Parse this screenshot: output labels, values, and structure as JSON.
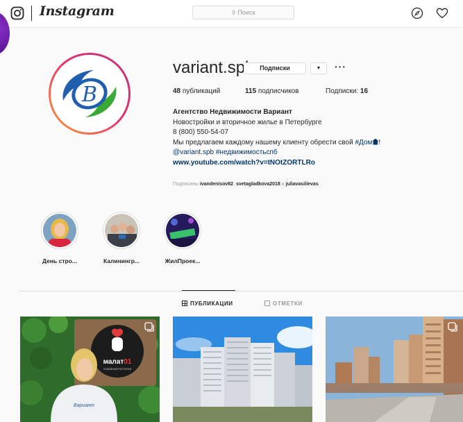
{
  "nav": {
    "brand": "Instagram",
    "search_placeholder": "Поиск"
  },
  "profile": {
    "username": "variant.spb",
    "follow_label": "Подписки",
    "stats": {
      "posts_count": "48",
      "posts_label": "публикаций",
      "followers_count": "115",
      "followers_label": "подписчиков",
      "following_label": "Подписки:",
      "following_count": "16"
    },
    "bio": {
      "name": "Агентство Недвижимости Вариант",
      "line1": "Новостройки и вторичное жилье в Петербурге",
      "phone": "8 (800) 550-54-07",
      "line3_text": "Мы предлагаем каждому нашему клиенту обрести свой",
      "line3_tag": "#Дом",
      "line3_end": "!",
      "line4_mention": "@variant.spb",
      "line4_tag": "#недвижимостьспб",
      "website": "www.youtube.com/watch?v=tNOtZORTLRo"
    },
    "followed_by": {
      "prefix": "Подписаны",
      "user1": "ivandenisov82",
      "sep": ",",
      "user2": "svetagladkova2018",
      "and": "и",
      "user3": "juliavasilievas"
    }
  },
  "highlights": [
    {
      "label": "День стро..."
    },
    {
      "label": "Калинингр..."
    },
    {
      "label": "ЖилПроек..."
    }
  ],
  "tabs": {
    "posts": "ПУБЛИКАЦИИ",
    "tagged": "ОТМЕТКИ"
  },
  "posts": [
    {
      "sign_text": "малат",
      "sign_number": "01",
      "sign_sub": "СЕМЕЙНЫЙ РЕСТОРАН",
      "shirt_text": "Вариант"
    },
    {},
    {}
  ],
  "colors": {
    "link": "#003569",
    "muted": "#999999",
    "ring_start": "#f9a13a",
    "ring_end": "#c13584",
    "logo_blue": "#1f5fae",
    "logo_green": "#3aa935"
  }
}
